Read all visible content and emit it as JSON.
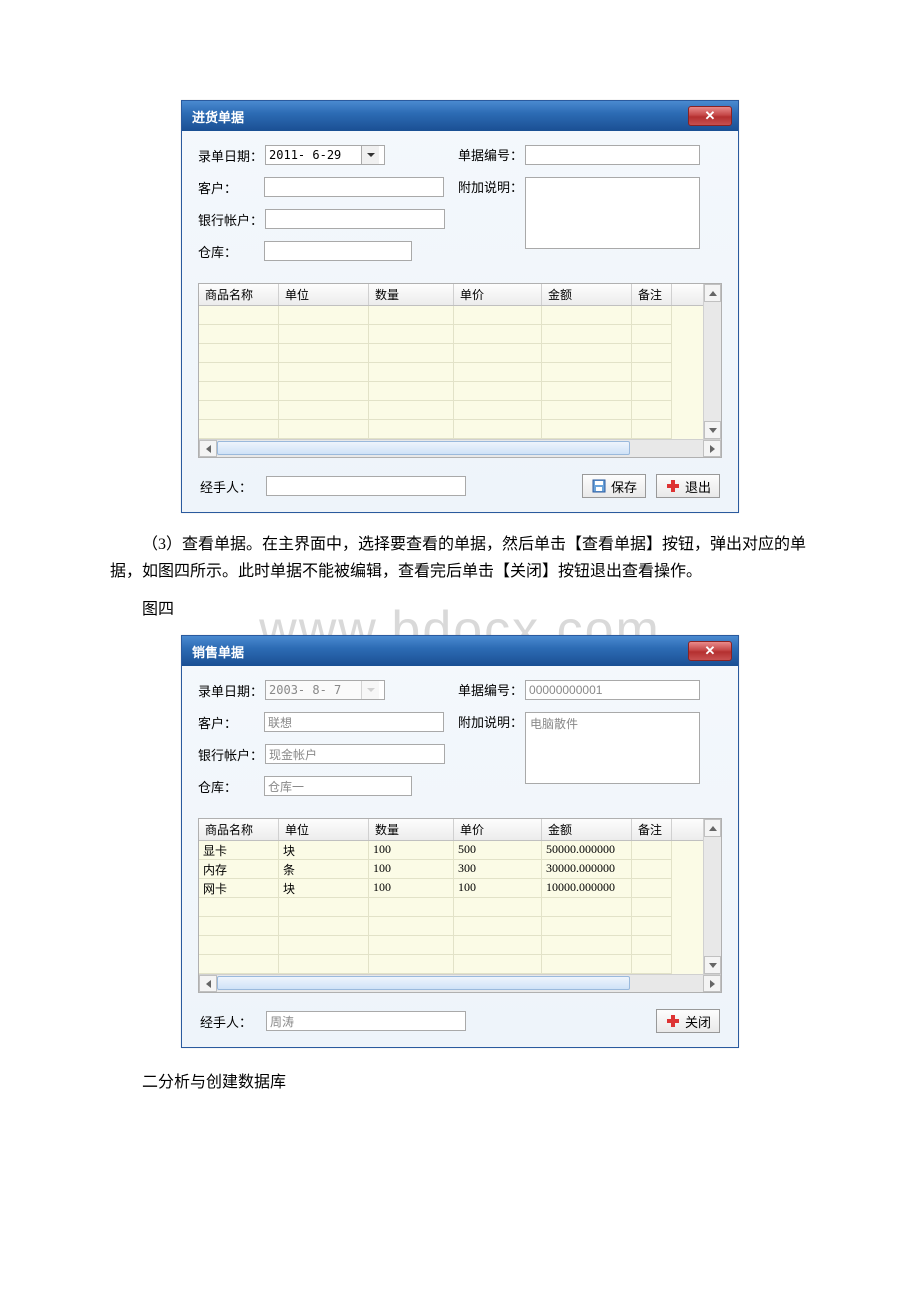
{
  "watermark": "www.bdocx.com",
  "window1": {
    "title": "进货单据",
    "labels": {
      "date": "录单日期：",
      "docno": "单据编号：",
      "customer": "客户：",
      "extra": "附加说明：",
      "bank": "银行帐户：",
      "warehouse": "仓库：",
      "handler": "经手人："
    },
    "values": {
      "date": "2011- 6-29",
      "docno": "",
      "customer": "",
      "extra": "",
      "bank": "",
      "warehouse": "",
      "handler": ""
    },
    "columns": [
      "商品名称",
      "单位",
      "数量",
      "单价",
      "金额",
      "备注"
    ],
    "rows": [],
    "buttons": {
      "save": "保存",
      "exit": "退出"
    }
  },
  "para1": "（3）查看单据。在主界面中，选择要查看的单据，然后单击【查看单据】按钮，弹出对应的单据，如图四所示。此时单据不能被编辑，查看完后单击【关闭】按钮退出查看操作。",
  "caption1": "图四",
  "window2": {
    "title": "销售单据",
    "labels": {
      "date": "录单日期：",
      "docno": "单据编号：",
      "customer": "客户：",
      "extra": "附加说明：",
      "bank": "银行帐户：",
      "warehouse": "仓库：",
      "handler": "经手人："
    },
    "values": {
      "date": "2003- 8- 7",
      "docno": "00000000001",
      "customer": "联想",
      "extra": "电脑散件",
      "bank": "现金帐户",
      "warehouse": "仓库一",
      "handler": "周涛"
    },
    "columns": [
      "商品名称",
      "单位",
      "数量",
      "单价",
      "金额",
      "备注"
    ],
    "rows": [
      {
        "name": "显卡",
        "unit": "块",
        "qty": "100",
        "price": "500",
        "amount": "50000.000000",
        "remark": ""
      },
      {
        "name": "内存",
        "unit": "条",
        "qty": "100",
        "price": "300",
        "amount": "30000.000000",
        "remark": ""
      },
      {
        "name": "网卡",
        "unit": "块",
        "qty": "100",
        "price": "100",
        "amount": "10000.000000",
        "remark": ""
      }
    ],
    "buttons": {
      "close": "关闭"
    }
  },
  "section2": "二分析与创建数据库"
}
